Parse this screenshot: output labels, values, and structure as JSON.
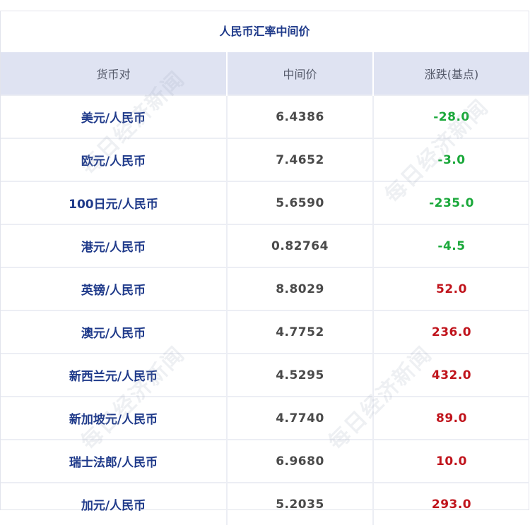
{
  "title": "人民币汇率中间价",
  "headers": [
    "货币对",
    "中间价",
    "涨跌(基点)"
  ],
  "rows": [
    {
      "pair": "美元/人民币",
      "mid": "6.4386",
      "change": "-28.0",
      "dir": "down"
    },
    {
      "pair": "欧元/人民币",
      "mid": "7.4652",
      "change": "-3.0",
      "dir": "down"
    },
    {
      "pair": "100日元/人民币",
      "mid": "5.6590",
      "change": "-235.0",
      "dir": "down"
    },
    {
      "pair": "港元/人民币",
      "mid": "0.82764",
      "change": "-4.5",
      "dir": "down"
    },
    {
      "pair": "英镑/人民币",
      "mid": "8.8029",
      "change": "52.0",
      "dir": "up"
    },
    {
      "pair": "澳元/人民币",
      "mid": "4.7752",
      "change": "236.0",
      "dir": "up"
    },
    {
      "pair": "新西兰元/人民币",
      "mid": "4.5295",
      "change": "432.0",
      "dir": "up"
    },
    {
      "pair": "新加坡元/人民币",
      "mid": "4.7740",
      "change": "89.0",
      "dir": "up"
    },
    {
      "pair": "瑞士法郎/人民币",
      "mid": "6.9680",
      "change": "10.0",
      "dir": "up"
    },
    {
      "pair": "加元/人民币",
      "mid": "5.2035",
      "change": "293.0",
      "dir": "up"
    }
  ],
  "watermark": "每日经济新闻",
  "colors": {
    "title": "#1f3a8a",
    "header_bg": "#dfe3f2",
    "down": "#1aa83a",
    "up": "#c0141c"
  }
}
